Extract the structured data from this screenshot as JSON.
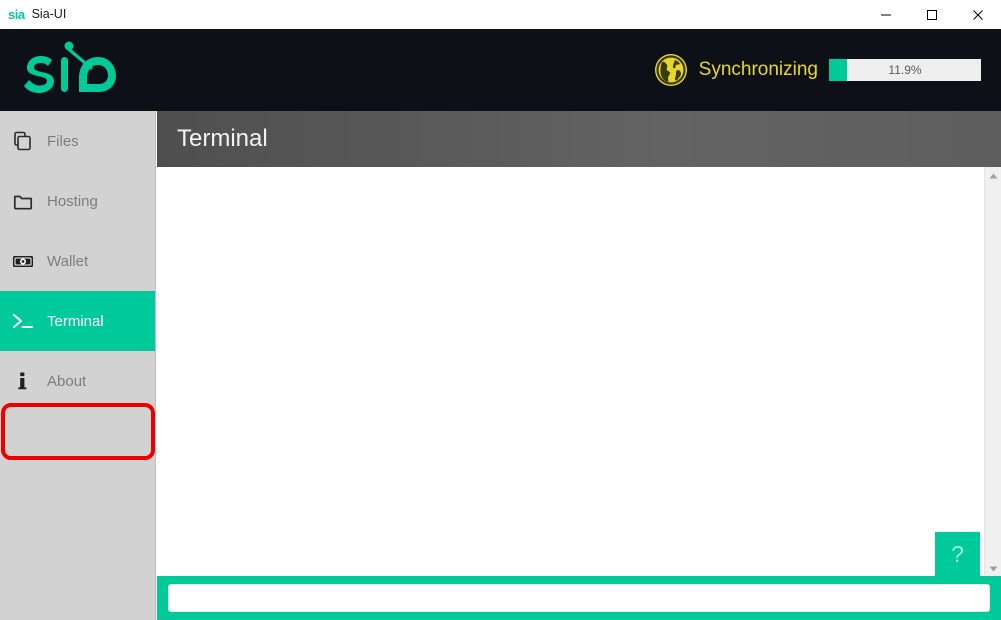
{
  "window": {
    "logo_text": "sia",
    "title": "Sia-UI",
    "controls": [
      {
        "name": "minimize",
        "glyph": "minimize-icon"
      },
      {
        "name": "maximize",
        "glyph": "maximize-icon"
      },
      {
        "name": "close",
        "glyph": "close-icon"
      }
    ]
  },
  "topbar": {
    "brand": "sia",
    "status": {
      "icon": "globe-icon",
      "label": "Synchronizing",
      "progress_percent": 11.9,
      "progress_text": "11.9%"
    }
  },
  "sidebar": {
    "items": [
      {
        "label": "Files",
        "icon": "copy-files-icon",
        "active": false
      },
      {
        "label": "Hosting",
        "icon": "folder-icon",
        "active": false
      },
      {
        "label": "Wallet",
        "icon": "banknote-icon",
        "active": false
      },
      {
        "label": "Terminal",
        "icon": "prompt-icon",
        "active": true
      },
      {
        "label": "About",
        "icon": "info-icon",
        "active": false
      }
    ]
  },
  "main": {
    "page_title": "Terminal",
    "console_output": "",
    "help_button_label": "?",
    "command_input": {
      "value": "",
      "placeholder": ""
    },
    "scrollbar": {
      "up_arrow": "chevron-up-icon",
      "down_arrow": "chevron-down-icon"
    }
  },
  "colors": {
    "accent_teal": "#00c99a",
    "topbar_dark": "#0d1016",
    "sidebar_gray": "#d2d2d2",
    "header_gray": "#595959",
    "sync_yellow": "#e8d726",
    "highlight_red": "#ee0000"
  }
}
